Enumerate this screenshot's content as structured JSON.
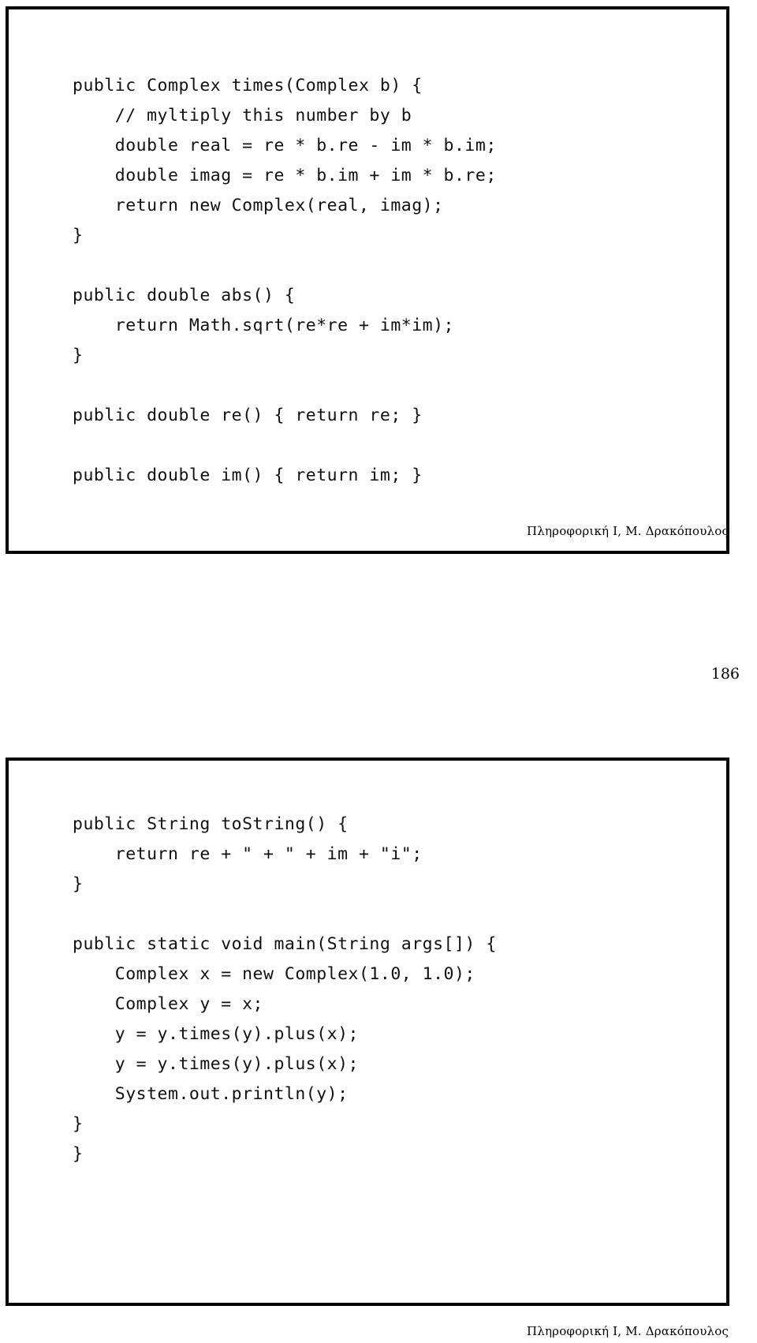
{
  "document": {
    "page_number": "186",
    "footer_text": "Πληροφορική Ι, Μ. Δρακόπουλος"
  },
  "slides": [
    {
      "id": "slide-complex-methods",
      "code_lines": [
        "public Complex times(Complex b) {",
        "    // myltiply this number by b",
        "    double real = re * b.re - im * b.im;",
        "    double imag = re * b.im + im * b.re;",
        "    return new Complex(real, imag);",
        "}",
        "",
        "public double abs() {",
        "    return Math.sqrt(re*re + im*im);",
        "}",
        "",
        "public double re() { return re; }",
        "",
        "public double im() { return im; }"
      ]
    },
    {
      "id": "slide-tostring-main",
      "code_lines": [
        "public String toString() {",
        "    return re + \" + \" + im + \"i\";",
        "}",
        "",
        "public static void main(String args[]) {",
        "    Complex x = new Complex(1.0, 1.0);",
        "    Complex y = x;",
        "    y = y.times(y).plus(x);",
        "    y = y.times(y).plus(x);",
        "    System.out.println(y);",
        "}",
        "}"
      ]
    }
  ]
}
